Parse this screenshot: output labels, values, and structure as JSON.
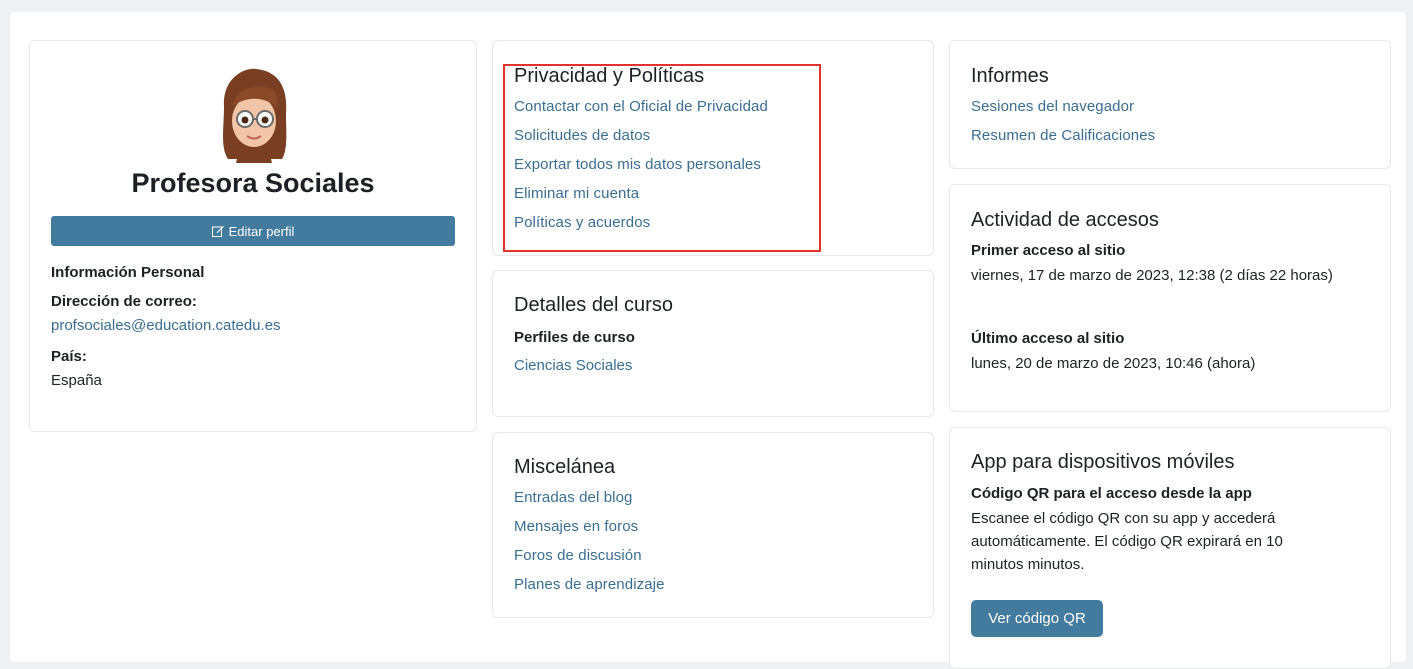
{
  "profile": {
    "name": "Profesora Sociales",
    "edit_button": "Editar perfil",
    "personal_info_heading": "Información Personal",
    "email_label": "Dirección de correo:",
    "email_value": "profsociales@education.catedu.es",
    "country_label": "País:",
    "country_value": "España"
  },
  "privacy": {
    "title": "Privacidad y Políticas",
    "links": [
      "Contactar con el Oficial de Privacidad",
      "Solicitudes de datos",
      "Exportar todos mis datos personales",
      "Eliminar mi cuenta",
      "Políticas y acuerdos"
    ]
  },
  "course_details": {
    "title": "Detalles del curso",
    "label": "Perfiles de curso",
    "link": "Ciencias Sociales"
  },
  "misc": {
    "title": "Miscelánea",
    "links": [
      "Entradas del blog",
      "Mensajes en foros",
      "Foros de discusión",
      "Planes de aprendizaje"
    ]
  },
  "reports": {
    "title": "Informes",
    "links": [
      "Sesiones del navegador",
      "Resumen de Calificaciones"
    ]
  },
  "access": {
    "title": "Actividad de accesos",
    "first_label": "Primer acceso al sitio",
    "first_value": "viernes, 17 de marzo de 2023, 12:38  (2 días 22 horas)",
    "last_label": "Último acceso al sitio",
    "last_value": "lunes, 20 de marzo de 2023, 10:46  (ahora)"
  },
  "mobile": {
    "title": "App para dispositivos móviles",
    "qr_label": "Código QR para el acceso desde la app",
    "qr_text": "Escanee el código QR con su app y accederá automáticamente. El código QR expirará en 10 minutos minutos.",
    "qr_button": "Ver código QR"
  },
  "colors": {
    "link": "#3a6e91",
    "button": "#437b9e",
    "highlight": "#e0332e"
  }
}
